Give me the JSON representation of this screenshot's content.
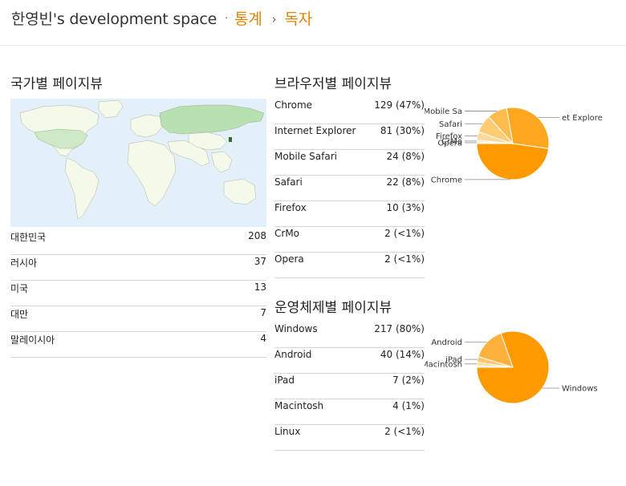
{
  "header": {
    "blog_name": "한영빈's development space",
    "sep1": "·",
    "crumb_stats": "통계",
    "sep2": "›",
    "crumb_readers": "독자"
  },
  "country": {
    "title": "국가별 페이지뷰",
    "rows": [
      {
        "name": "대한민국",
        "value": "208"
      },
      {
        "name": "러시아",
        "value": "37"
      },
      {
        "name": "미국",
        "value": "13"
      },
      {
        "name": "대만",
        "value": "7"
      },
      {
        "name": "말레이시아",
        "value": "4"
      }
    ]
  },
  "browser": {
    "title": "브라우저별 페이지뷰",
    "rows": [
      {
        "name": "Chrome",
        "value": "129 (47%)"
      },
      {
        "name": "Internet Explorer",
        "value": "81 (30%)"
      },
      {
        "name": "Mobile Safari",
        "value": "24 (8%)"
      },
      {
        "name": "Safari",
        "value": "22 (8%)"
      },
      {
        "name": "Firefox",
        "value": "10 (3%)"
      },
      {
        "name": "CrMo",
        "value": "2 (<1%)"
      },
      {
        "name": "Opera",
        "value": "2 (<1%)"
      }
    ]
  },
  "os": {
    "title": "운영체제별 페이지뷰",
    "rows": [
      {
        "name": "Windows",
        "value": "217 (80%)"
      },
      {
        "name": "Android",
        "value": "40 (14%)"
      },
      {
        "name": "iPad",
        "value": "7 (2%)"
      },
      {
        "name": "Macintosh",
        "value": "4 (1%)"
      },
      {
        "name": "Linux",
        "value": "2 (<1%)"
      }
    ]
  },
  "chart_data": [
    {
      "type": "pie",
      "categories": [
        "Chrome",
        "Internet Explorer",
        "Mobile Safari",
        "Safari",
        "Firefox",
        "CrMo",
        "Opera"
      ],
      "values": [
        129,
        81,
        24,
        22,
        10,
        2,
        2
      ],
      "labels": [
        "Chrome",
        "et Explorer",
        "Mobile Sa",
        "Safari",
        "Firefox",
        "CrMo",
        "Opera"
      ],
      "colors": [
        "#ff9900",
        "#ffa81f",
        "#ffbb4d",
        "#ffcb73",
        "#ffd999",
        "#ffe4b3",
        "#ffeecc"
      ]
    },
    {
      "type": "pie",
      "categories": [
        "Windows",
        "Android",
        "iPad",
        "Macintosh",
        "Linux"
      ],
      "values": [
        217,
        40,
        7,
        4,
        2
      ],
      "labels": [
        "Windows",
        "Android",
        "iPad",
        "Macintosh",
        ""
      ],
      "colors": [
        "#ff9900",
        "#ffb13d",
        "#ffc766",
        "#ffd999",
        "#ffe8c2"
      ]
    }
  ]
}
